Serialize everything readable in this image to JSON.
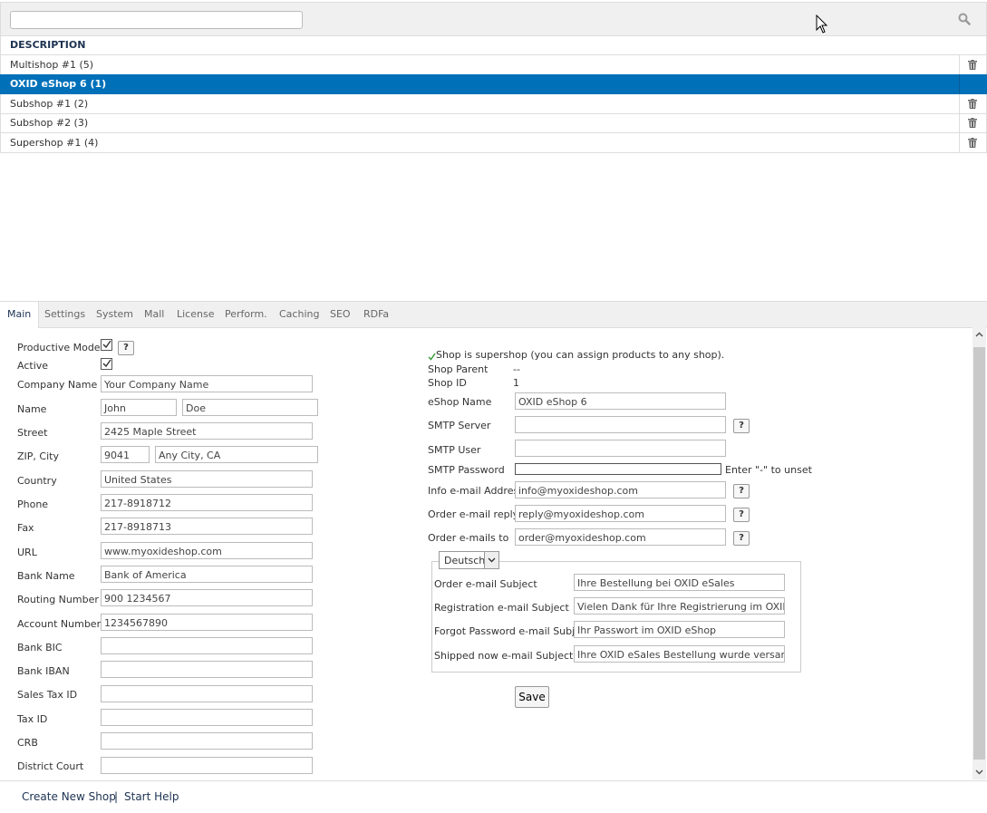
{
  "list": {
    "search_value": "",
    "column_header": "DESCRIPTION",
    "rows": [
      {
        "label": "Multishop #1 (5)"
      },
      {
        "label": "OXID eShop 6 (1)"
      },
      {
        "label": "Subshop #1 (2)"
      },
      {
        "label": "Subshop #2 (3)"
      },
      {
        "label": "Supershop #1 (4)"
      }
    ]
  },
  "tabs": [
    "Main",
    "Settings",
    "System",
    "Mall",
    "License",
    "Perform.",
    "Caching",
    "SEO",
    "RDFa"
  ],
  "left_form": {
    "productive_mode_label": "Productive Mode",
    "active_label": "Active",
    "company_name_label": "Company Name",
    "company_name": "Your Company Name",
    "name_label": "Name",
    "first_name": "John",
    "last_name": "Doe",
    "street_label": "Street",
    "street": "2425 Maple Street",
    "zip_city_label": "ZIP, City",
    "zip": "9041",
    "city": "Any City, CA",
    "country_label": "Country",
    "country": "United States",
    "phone_label": "Phone",
    "phone": "217-8918712",
    "fax_label": "Fax",
    "fax": "217-8918713",
    "url_label": "URL",
    "url": "www.myoxideshop.com",
    "bank_name_label": "Bank Name",
    "bank_name": "Bank of America",
    "routing_label": "Routing Number",
    "routing": "900 1234567",
    "account_label": "Account Number",
    "account": "1234567890",
    "bic_label": "Bank BIC",
    "bic": "",
    "iban_label": "Bank IBAN",
    "iban": "",
    "sales_tax_label": "Sales Tax ID",
    "sales_tax": "",
    "tax_label": "Tax ID",
    "tax": "",
    "crb_label": "CRB",
    "crb": "",
    "court_label": "District Court",
    "court": ""
  },
  "right_form": {
    "supershop_note": "Shop is supershop (you can assign products to any shop).",
    "parent_label": "Shop Parent",
    "parent_value": "--",
    "shop_id_label": "Shop ID",
    "shop_id_value": "1",
    "eshop_name_label": "eShop Name",
    "eshop_name": "OXID eShop 6",
    "smtp_server_label": "SMTP Server",
    "smtp_server": "",
    "smtp_user_label": "SMTP User",
    "smtp_user": "",
    "smtp_password_label": "SMTP Password",
    "smtp_password": "",
    "smtp_password_hint": "Enter \"-\" to unset",
    "info_email_label": "Info e-mail Address",
    "info_email": "info@myoxideshop.com",
    "order_reply_label": "Order e-mail reply",
    "order_reply": "reply@myoxideshop.com",
    "order_to_label": "Order e-mails to",
    "order_to": "order@myoxideshop.com",
    "language": "Deutsch",
    "order_subject_label": "Order e-mail Subject",
    "order_subject": "Ihre Bestellung bei OXID eSales",
    "registration_subject_label": "Registration e-mail Subject",
    "registration_subject": "Vielen Dank für Ihre Registrierung im OXID eShop",
    "forgot_subject_label": "Forgot Password e-mail Subject",
    "forgot_subject": "Ihr Passwort im OXID eShop",
    "shipped_subject_label": "Shipped now e-mail Subject",
    "shipped_subject": "Ihre OXID eSales Bestellung wurde versandt",
    "help_glyph": "?",
    "save_label": "Save"
  },
  "footer": {
    "create_label": "Create New Shop",
    "separator": "|",
    "help_label": "Start Help"
  },
  "colors": {
    "selected_row": "#0070b9",
    "heading": "#1d3352"
  },
  "icons": [
    "search-icon",
    "trash-icon",
    "check-icon",
    "help-icon",
    "chevron-down-icon",
    "mouse-cursor-icon"
  ]
}
